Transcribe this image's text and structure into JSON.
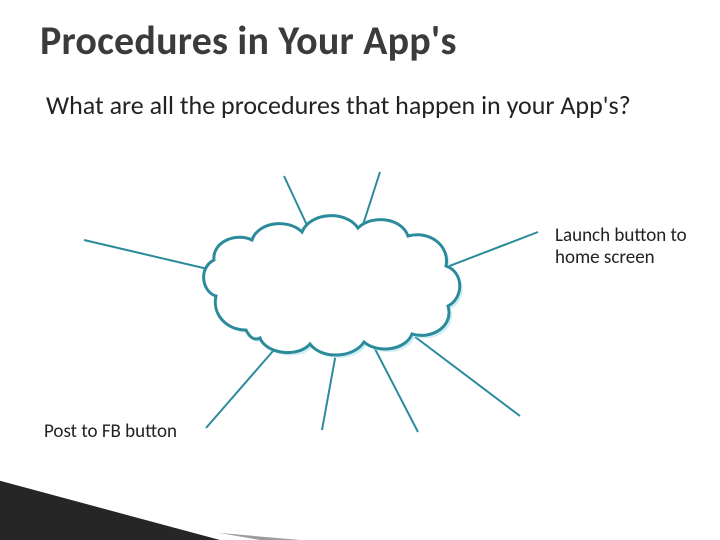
{
  "title": "Procedures in Your App's",
  "subtitle": "What are all the procedures that happen in your App's?",
  "labels": {
    "right": "Launch button to home screen",
    "left": "Post to FB button"
  },
  "colors": {
    "line": "#2b8b9b",
    "cloud_stroke": "#2b8b9b",
    "cloud_fill": "#ffffff",
    "cloud_shadow": "#cfeef4",
    "wedge_dark": "#262626",
    "wedge_gray": "#9c9c9c"
  }
}
